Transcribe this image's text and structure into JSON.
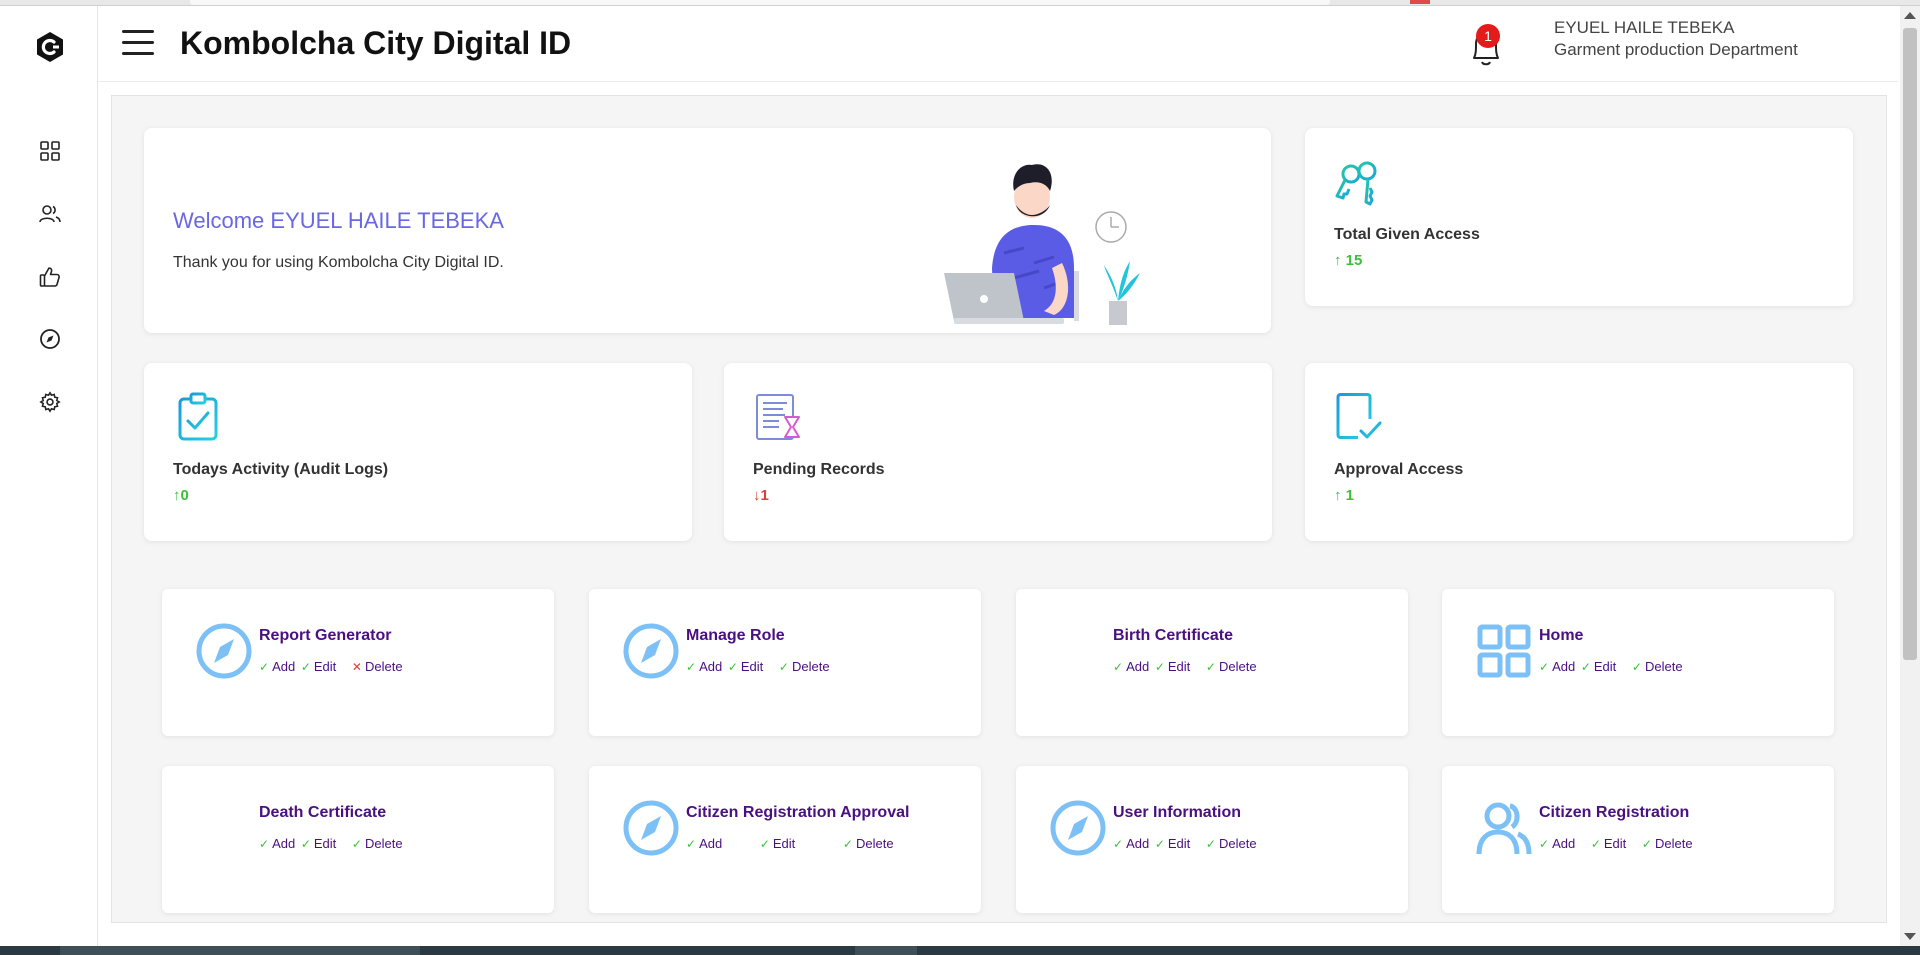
{
  "header": {
    "title": "Kombolcha City Digital ID",
    "notification_count": "1",
    "user_name": "EYUEL HAILE TEBEKA",
    "user_department": "Garment production Department"
  },
  "sidebar": {
    "icons": [
      "logo-icon",
      "dashboard-grid-icon",
      "users-icon",
      "thumbs-up-icon",
      "compass-icon",
      "gear-icon"
    ]
  },
  "welcome": {
    "title": "Welcome EYUEL HAILE TEBEKA",
    "message": "Thank you for using Kombolcha City Digital ID."
  },
  "stats": [
    {
      "label": "Total Given Access",
      "arrow": "↑",
      "value": "15",
      "trend": "up"
    },
    {
      "label": "Todays Activity (Audit Logs)",
      "arrow": "↑",
      "value": "0",
      "trend": "up"
    },
    {
      "label": "Pending Records",
      "arrow": "↓",
      "value": "1",
      "trend": "down"
    },
    {
      "label": "Approval Access",
      "arrow": "↑",
      "value": "1",
      "trend": "up"
    }
  ],
  "permissions": [
    {
      "title": "Report Generator",
      "icon": "compass-icon",
      "add": "Add",
      "edit": "Edit",
      "delete": "Delete",
      "add_ok": true,
      "edit_ok": true,
      "delete_ok": false
    },
    {
      "title": "Manage Role",
      "icon": "compass-icon",
      "add": "Add",
      "edit": "Edit",
      "delete": "Delete",
      "add_ok": true,
      "edit_ok": true,
      "delete_ok": true
    },
    {
      "title": "Birth Certificate",
      "icon": "none",
      "add": "Add",
      "edit": "Edit",
      "delete": "Delete",
      "add_ok": true,
      "edit_ok": true,
      "delete_ok": true
    },
    {
      "title": "Home",
      "icon": "grid-icon",
      "add": "Add",
      "edit": "Edit",
      "delete": "Delete",
      "add_ok": true,
      "edit_ok": true,
      "delete_ok": true
    },
    {
      "title": "Death Certificate",
      "icon": "none",
      "add": "Add",
      "edit": "Edit",
      "delete": "Delete",
      "add_ok": true,
      "edit_ok": true,
      "delete_ok": true
    },
    {
      "title": "Citizen Registration Approval",
      "icon": "compass-icon",
      "add": "Add",
      "edit": "Edit",
      "delete": "Delete",
      "add_ok": true,
      "edit_ok": true,
      "delete_ok": true
    },
    {
      "title": "User Information",
      "icon": "compass-icon",
      "add": "Add",
      "edit": "Edit",
      "delete": "Delete",
      "add_ok": true,
      "edit_ok": true,
      "delete_ok": true
    },
    {
      "title": "Citizen Registration",
      "icon": "users-icon",
      "add": "Add",
      "edit": "Edit",
      "delete": "Delete",
      "add_ok": true,
      "edit_ok": true,
      "delete_ok": true
    }
  ],
  "colors": {
    "accent": "#6a67e3",
    "permission_title": "#4a1080",
    "up": "#3cbf3c",
    "down": "#e43b3b",
    "icon_blue": "#7cc0f5",
    "badge": "#e21b1b"
  }
}
